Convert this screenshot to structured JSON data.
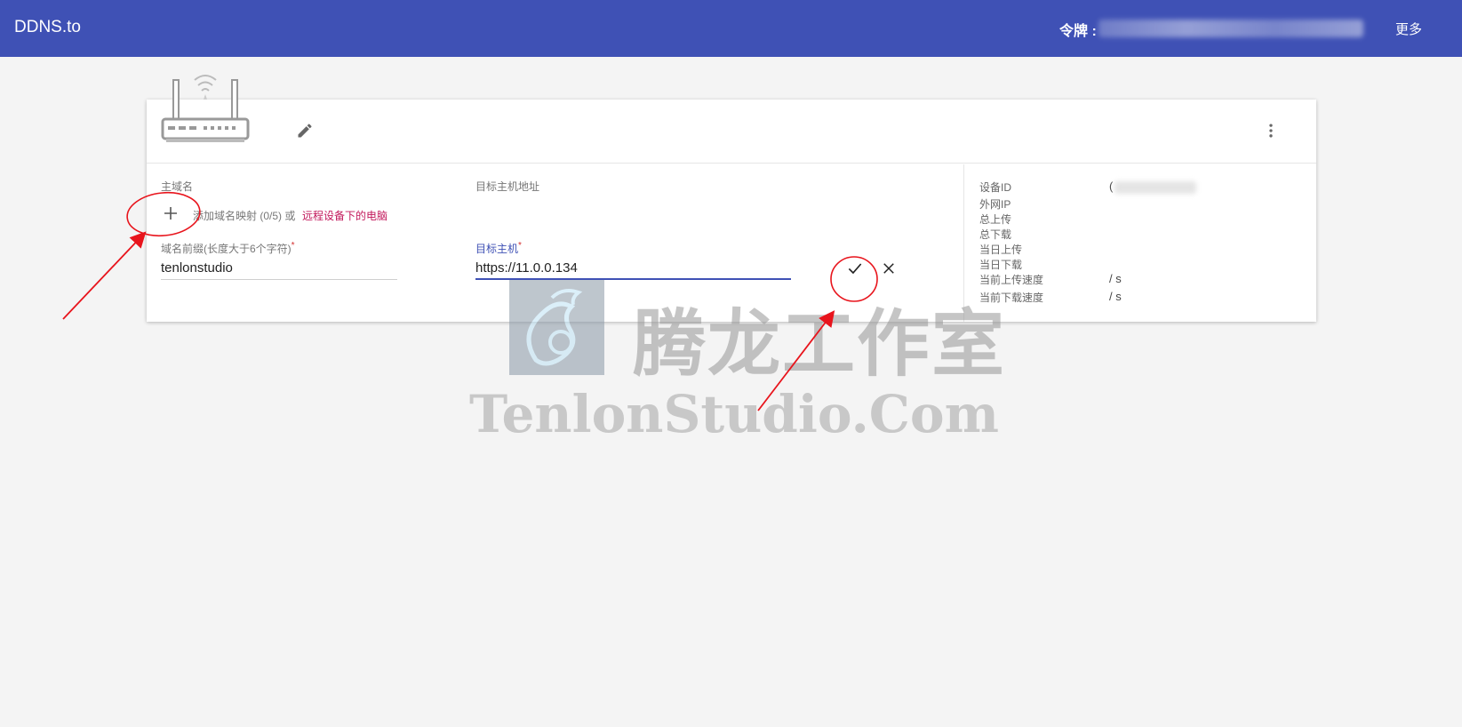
{
  "header": {
    "brand": "DDNS.to",
    "token_label": "令牌 :",
    "more_label": "更多"
  },
  "card": {
    "host_section_label": "主域名",
    "target_section_label": "目标主机地址",
    "add_hint": "添加域名映射 (0/5) 或",
    "remote_link": "远程设备下的电脑",
    "prefix_label": "域名前缀(长度大于6个字符)",
    "prefix_value": "tenlonstudio",
    "target_host_label": "目标主机",
    "target_host_value": "https://11.0.0.134",
    "required_mark": "*"
  },
  "device_info": {
    "device_id_label": "设备ID",
    "device_id_prefix": "(",
    "public_ip_label": "外网IP",
    "total_upload_label": "总上传",
    "total_download_label": "总下载",
    "today_upload_label": "当日上传",
    "today_download_label": "当日下载",
    "upload_speed_label": "当前上传速度",
    "upload_speed_value": "/ s",
    "download_speed_label": "当前下载速度",
    "download_speed_value": "/ s"
  },
  "watermark": {
    "cn": "腾龙工作室",
    "en": "TenlonStudio.Com"
  },
  "colors": {
    "primary": "#3f51b5",
    "link": "#c2185b",
    "annotation": "#e8141c"
  },
  "icons": [
    "router-icon",
    "pencil-icon",
    "more-vert-icon",
    "plus-icon",
    "check-icon",
    "close-icon",
    "dragon-logo-icon"
  ]
}
